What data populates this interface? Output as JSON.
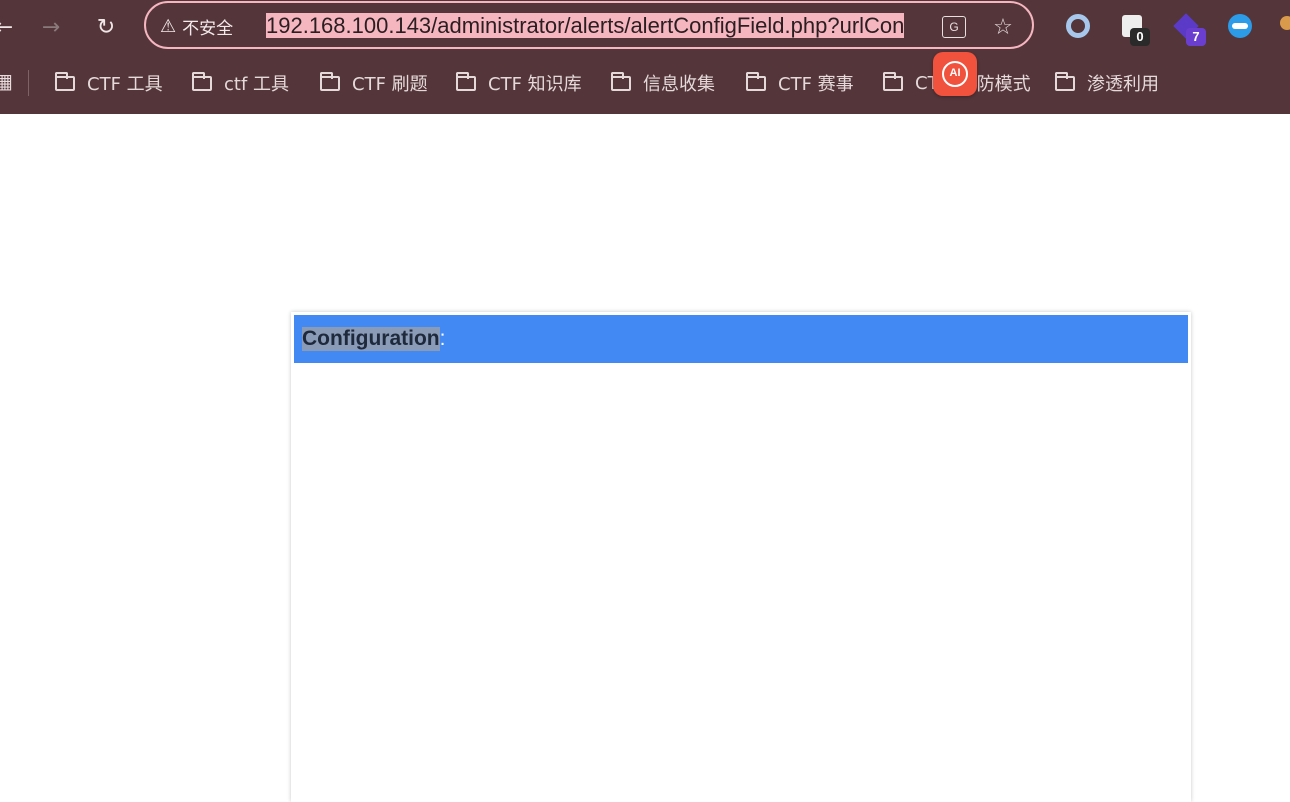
{
  "browser": {
    "security_label": "不安全",
    "url": "192.168.100.143/administrator/alerts/alertConfigField.php?urlCon",
    "translate_label": "G",
    "extension_badges": [
      "0",
      "7"
    ],
    "ai_label": "AI",
    "bookmarks": [
      "CTF 工具",
      "ctf 工具",
      "CTF 刷题",
      "CTF 知识库",
      "信息收集",
      "CTF 赛事",
      "CT",
      "防模式",
      "渗透利用"
    ]
  },
  "page": {
    "config_label": "Configuration",
    "config_suffix": ":"
  },
  "colors": {
    "chrome_bg": "#53353a",
    "omnibox_border": "#f5b6c0",
    "header_blue": "#4389f4",
    "ai_red": "#f1523e"
  }
}
